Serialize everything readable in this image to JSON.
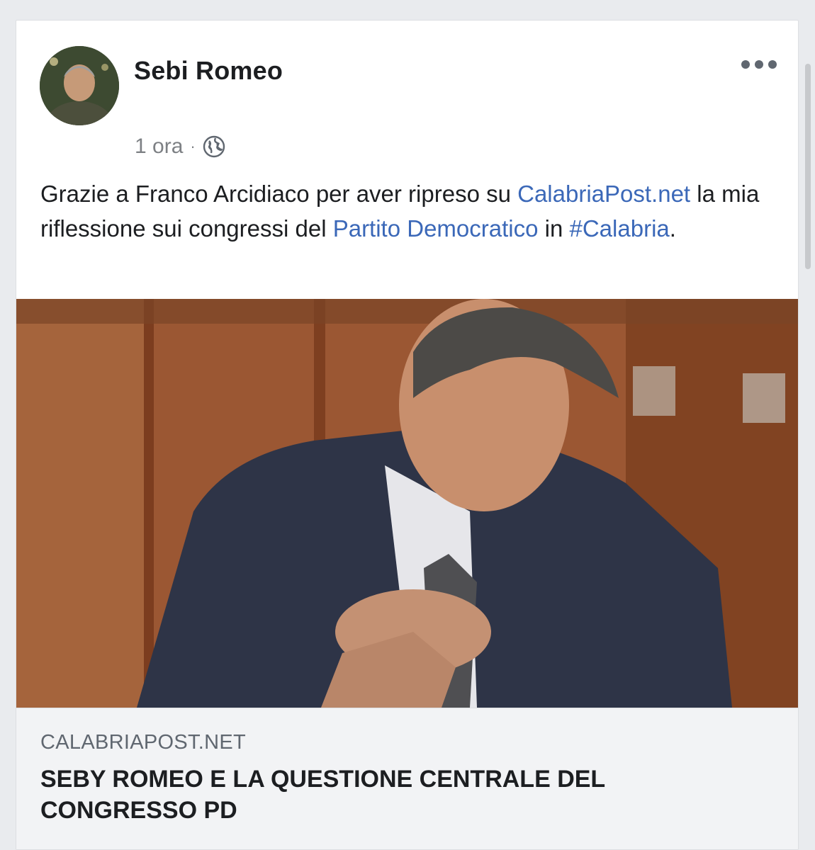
{
  "post": {
    "author": "Sebi Romeo",
    "time": "1 ora",
    "separator": "·",
    "privacy_icon": "globe-icon",
    "more_icon": "more-options-icon",
    "text": {
      "part1": "Grazie a Franco Arcidiaco per aver ripreso su",
      "link1": "CalabriaPost.net",
      "part2": "la mia riflessione sui congressi del",
      "link2": "Partito Democratico",
      "part3": "in",
      "hashtag": "#Calabria",
      "end": "."
    }
  },
  "link_preview": {
    "domain": "CALABRIAPOST.NET",
    "title": "SEBY ROMEO E LA QUESTIONE CENTRALE DEL CONGRESSO PD"
  },
  "colors": {
    "link": "#3b68b8",
    "text": "#1c1e21",
    "meta": "#7d8084",
    "preview_bg": "#f2f3f5"
  }
}
